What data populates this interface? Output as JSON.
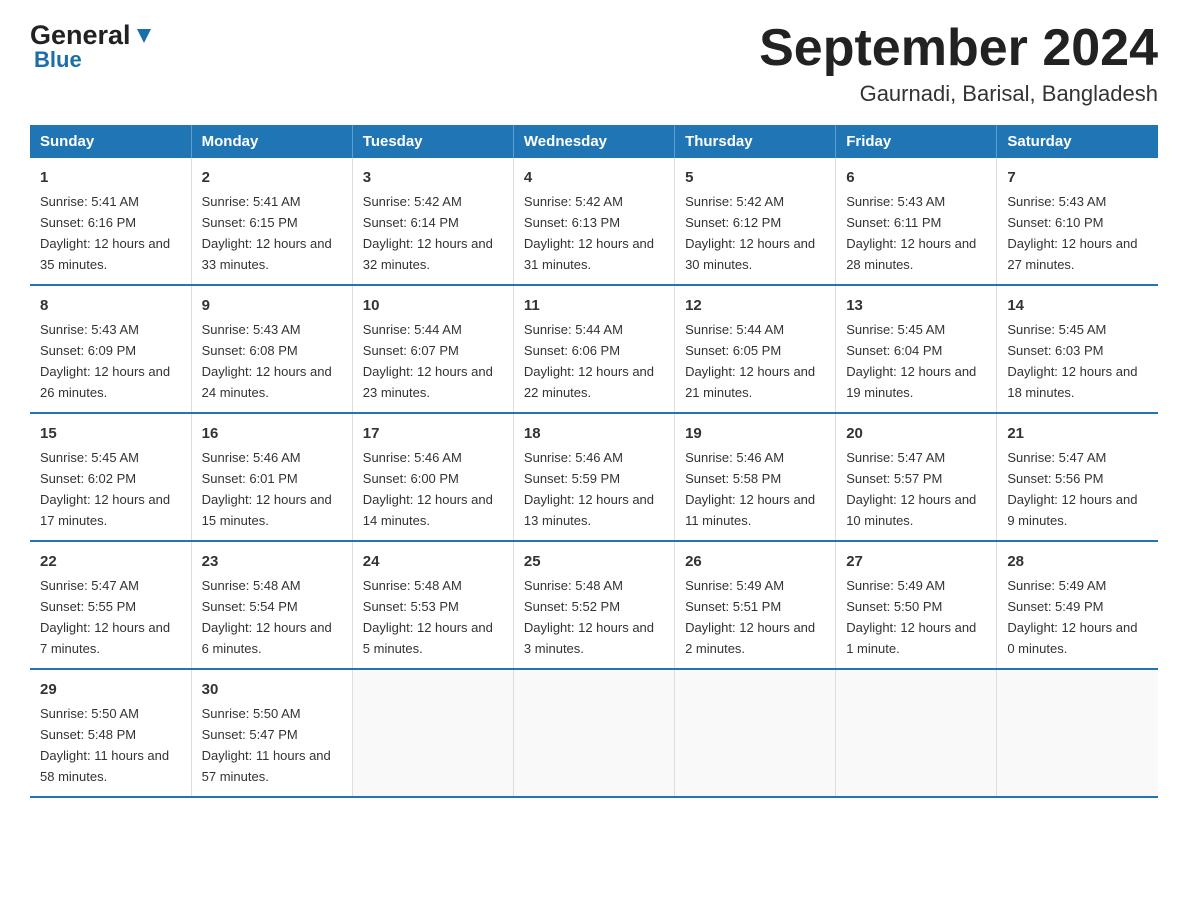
{
  "logo": {
    "general": "General",
    "blue": "Blue"
  },
  "title": "September 2024",
  "subtitle": "Gaurnadi, Barisal, Bangladesh",
  "days": [
    "Sunday",
    "Monday",
    "Tuesday",
    "Wednesday",
    "Thursday",
    "Friday",
    "Saturday"
  ],
  "weeks": [
    [
      {
        "day": "1",
        "sunrise": "5:41 AM",
        "sunset": "6:16 PM",
        "daylight": "12 hours and 35 minutes."
      },
      {
        "day": "2",
        "sunrise": "5:41 AM",
        "sunset": "6:15 PM",
        "daylight": "12 hours and 33 minutes."
      },
      {
        "day": "3",
        "sunrise": "5:42 AM",
        "sunset": "6:14 PM",
        "daylight": "12 hours and 32 minutes."
      },
      {
        "day": "4",
        "sunrise": "5:42 AM",
        "sunset": "6:13 PM",
        "daylight": "12 hours and 31 minutes."
      },
      {
        "day": "5",
        "sunrise": "5:42 AM",
        "sunset": "6:12 PM",
        "daylight": "12 hours and 30 minutes."
      },
      {
        "day": "6",
        "sunrise": "5:43 AM",
        "sunset": "6:11 PM",
        "daylight": "12 hours and 28 minutes."
      },
      {
        "day": "7",
        "sunrise": "5:43 AM",
        "sunset": "6:10 PM",
        "daylight": "12 hours and 27 minutes."
      }
    ],
    [
      {
        "day": "8",
        "sunrise": "5:43 AM",
        "sunset": "6:09 PM",
        "daylight": "12 hours and 26 minutes."
      },
      {
        "day": "9",
        "sunrise": "5:43 AM",
        "sunset": "6:08 PM",
        "daylight": "12 hours and 24 minutes."
      },
      {
        "day": "10",
        "sunrise": "5:44 AM",
        "sunset": "6:07 PM",
        "daylight": "12 hours and 23 minutes."
      },
      {
        "day": "11",
        "sunrise": "5:44 AM",
        "sunset": "6:06 PM",
        "daylight": "12 hours and 22 minutes."
      },
      {
        "day": "12",
        "sunrise": "5:44 AM",
        "sunset": "6:05 PM",
        "daylight": "12 hours and 21 minutes."
      },
      {
        "day": "13",
        "sunrise": "5:45 AM",
        "sunset": "6:04 PM",
        "daylight": "12 hours and 19 minutes."
      },
      {
        "day": "14",
        "sunrise": "5:45 AM",
        "sunset": "6:03 PM",
        "daylight": "12 hours and 18 minutes."
      }
    ],
    [
      {
        "day": "15",
        "sunrise": "5:45 AM",
        "sunset": "6:02 PM",
        "daylight": "12 hours and 17 minutes."
      },
      {
        "day": "16",
        "sunrise": "5:46 AM",
        "sunset": "6:01 PM",
        "daylight": "12 hours and 15 minutes."
      },
      {
        "day": "17",
        "sunrise": "5:46 AM",
        "sunset": "6:00 PM",
        "daylight": "12 hours and 14 minutes."
      },
      {
        "day": "18",
        "sunrise": "5:46 AM",
        "sunset": "5:59 PM",
        "daylight": "12 hours and 13 minutes."
      },
      {
        "day": "19",
        "sunrise": "5:46 AM",
        "sunset": "5:58 PM",
        "daylight": "12 hours and 11 minutes."
      },
      {
        "day": "20",
        "sunrise": "5:47 AM",
        "sunset": "5:57 PM",
        "daylight": "12 hours and 10 minutes."
      },
      {
        "day": "21",
        "sunrise": "5:47 AM",
        "sunset": "5:56 PM",
        "daylight": "12 hours and 9 minutes."
      }
    ],
    [
      {
        "day": "22",
        "sunrise": "5:47 AM",
        "sunset": "5:55 PM",
        "daylight": "12 hours and 7 minutes."
      },
      {
        "day": "23",
        "sunrise": "5:48 AM",
        "sunset": "5:54 PM",
        "daylight": "12 hours and 6 minutes."
      },
      {
        "day": "24",
        "sunrise": "5:48 AM",
        "sunset": "5:53 PM",
        "daylight": "12 hours and 5 minutes."
      },
      {
        "day": "25",
        "sunrise": "5:48 AM",
        "sunset": "5:52 PM",
        "daylight": "12 hours and 3 minutes."
      },
      {
        "day": "26",
        "sunrise": "5:49 AM",
        "sunset": "5:51 PM",
        "daylight": "12 hours and 2 minutes."
      },
      {
        "day": "27",
        "sunrise": "5:49 AM",
        "sunset": "5:50 PM",
        "daylight": "12 hours and 1 minute."
      },
      {
        "day": "28",
        "sunrise": "5:49 AM",
        "sunset": "5:49 PM",
        "daylight": "12 hours and 0 minutes."
      }
    ],
    [
      {
        "day": "29",
        "sunrise": "5:50 AM",
        "sunset": "5:48 PM",
        "daylight": "11 hours and 58 minutes."
      },
      {
        "day": "30",
        "sunrise": "5:50 AM",
        "sunset": "5:47 PM",
        "daylight": "11 hours and 57 minutes."
      },
      null,
      null,
      null,
      null,
      null
    ]
  ]
}
